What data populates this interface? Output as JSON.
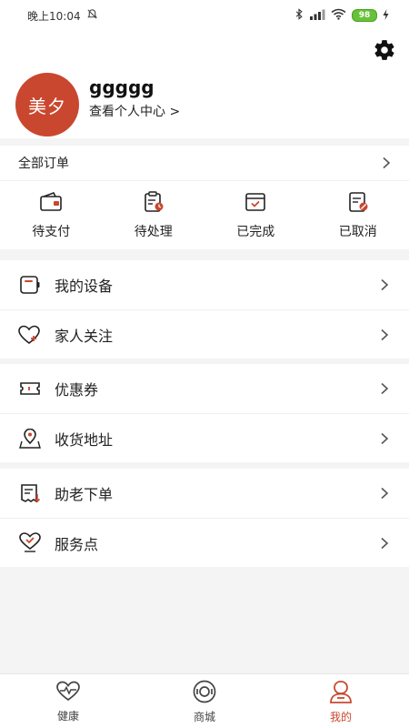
{
  "status_bar": {
    "time": "晚上10:04",
    "battery": "98"
  },
  "profile": {
    "avatar_text": "美夕",
    "username": "ggggg",
    "center_link": "查看个人中心 >"
  },
  "orders": {
    "title": "全部订单",
    "items": [
      {
        "label": "待支付",
        "icon": "wallet-icon"
      },
      {
        "label": "待处理",
        "icon": "pending-clipboard-icon"
      },
      {
        "label": "已完成",
        "icon": "completed-box-icon"
      },
      {
        "label": "已取消",
        "icon": "cancelled-document-icon"
      }
    ]
  },
  "menu": {
    "device": {
      "label": "我的设备",
      "icon": "device-icon"
    },
    "family": {
      "label": "家人关注",
      "icon": "heart-plus-icon"
    },
    "coupon": {
      "label": "优惠券",
      "icon": "ticket-icon"
    },
    "address": {
      "label": "收货地址",
      "icon": "location-pin-icon"
    },
    "assist_order": {
      "label": "助老下单",
      "icon": "receipt-icon"
    },
    "service_point": {
      "label": "服务点",
      "icon": "heart-check-icon"
    }
  },
  "bottom_nav": {
    "items": [
      {
        "label": "健康",
        "icon": "heartbeat-icon"
      },
      {
        "label": "商城",
        "icon": "mall-icon"
      },
      {
        "label": "我的",
        "icon": "profile-icon"
      }
    ],
    "active_index": 2
  },
  "colors": {
    "accent": "#c9472e",
    "background": "#f4f4f5"
  }
}
